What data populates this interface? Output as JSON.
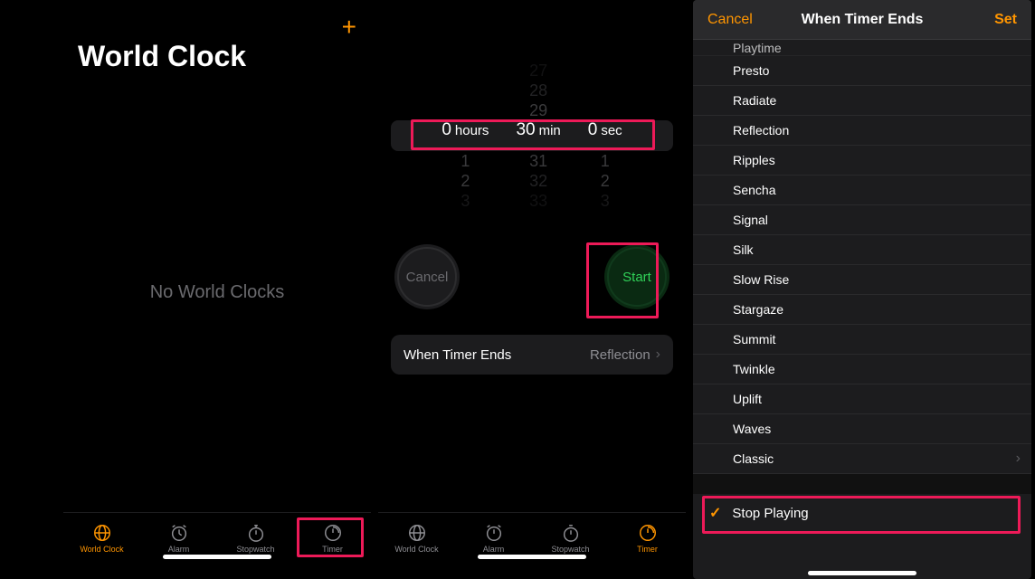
{
  "phone1": {
    "title": "World Clock",
    "empty": "No World Clocks",
    "tabs": [
      "World Clock",
      "Alarm",
      "Stopwatch",
      "Timer"
    ],
    "activeTab": 0
  },
  "phone2": {
    "picker": {
      "hours_above": [
        "",
        "",
        ""
      ],
      "hours_sel": "0",
      "hours_unit": "hours",
      "hours_below": [
        "1",
        "2",
        "3"
      ],
      "min_above": [
        "27",
        "28",
        "29"
      ],
      "min_sel": "30",
      "min_unit": "min",
      "min_below": [
        "31",
        "32",
        "33"
      ],
      "sec_above": [
        "",
        "",
        ""
      ],
      "sec_sel": "0",
      "sec_unit": "sec",
      "sec_below": [
        "1",
        "2",
        "3"
      ]
    },
    "cancel": "Cancel",
    "start": "Start",
    "when_label": "When Timer Ends",
    "when_value": "Reflection",
    "tabs": [
      "World Clock",
      "Alarm",
      "Stopwatch",
      "Timer"
    ],
    "activeTab": 3
  },
  "phone3": {
    "cancel": "Cancel",
    "title": "When Timer Ends",
    "set": "Set",
    "sounds": [
      "Playtime",
      "Presto",
      "Radiate",
      "Reflection",
      "Ripples",
      "Sencha",
      "Signal",
      "Silk",
      "Slow Rise",
      "Stargaze",
      "Summit",
      "Twinkle",
      "Uplift",
      "Waves",
      "Classic"
    ],
    "stop": "Stop Playing"
  }
}
